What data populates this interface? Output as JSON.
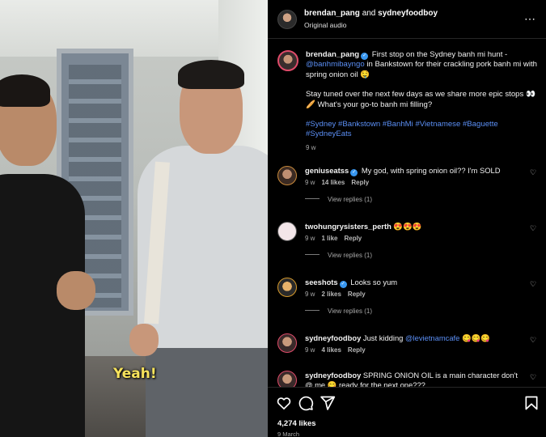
{
  "video": {
    "subtitle": "Yeah!"
  },
  "header": {
    "author": "brendan_pang",
    "and_label": "and",
    "collaborator": "sydneyfoodboy",
    "audio": "Original audio"
  },
  "caption": {
    "username": "brendan_pang",
    "line1": "First stop on the Sydney banh mi hunt -",
    "mention": "@banhmibayngo",
    "line2": "in Bankstown for their crackling pork banh mi with spring onion oil 🤤",
    "para2": "Stay tuned over the next few days as we share more epic stops 👀🥖 What's your go-to banh mi filling?",
    "hashtags": "#Sydney #Bankstown #BanhMi #Vietnamese #Baguette #SydneyEats",
    "age": "9 w"
  },
  "comments": [
    {
      "username": "geniuseatss",
      "verified": true,
      "text": "My god, with spring onion oil?? I'm SOLD",
      "age": "9 w",
      "likes": "14 likes",
      "reply": "Reply",
      "view_replies": "View replies (1)"
    },
    {
      "username": "twohungrysisters_perth",
      "verified": false,
      "text": "😍😍😍",
      "age": "9 w",
      "likes": "1 like",
      "reply": "Reply",
      "view_replies": "View replies (1)"
    },
    {
      "username": "seeshots",
      "verified": true,
      "text": "Looks so yum",
      "age": "9 w",
      "likes": "2 likes",
      "reply": "Reply",
      "view_replies": "View replies (1)"
    },
    {
      "username": "sydneyfoodboy",
      "verified": false,
      "text": "Just kidding",
      "mention": "@levietnamcafe",
      "emoji": "😋😋😋",
      "age": "9 w",
      "likes": "4 likes",
      "reply": "Reply"
    },
    {
      "username": "sydneyfoodboy",
      "verified": false,
      "text": "SPRING ONION OIL is a main character don't @ me 😋 ready for the next one???"
    }
  ],
  "footer": {
    "likes": "4,274 likes",
    "date": "9 March"
  },
  "icons": [
    "more-icon",
    "heart-icon",
    "comment-icon",
    "share-icon",
    "bookmark-icon",
    "verified-icon"
  ],
  "colors": {
    "link": "#5b8ff5",
    "verified": "#3897f0",
    "subtitle": "#f7e35c"
  }
}
